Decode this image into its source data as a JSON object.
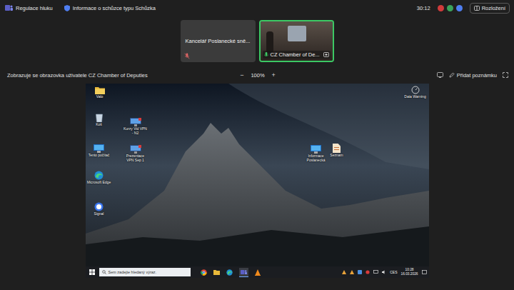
{
  "window": {
    "title": "Regulace hluku"
  },
  "meeting_info": {
    "label": "Informace o schůzce typu Schůzka"
  },
  "timer": "30:12",
  "status_icons": [
    {
      "name": "recording",
      "color": "#d13b3b"
    },
    {
      "name": "copilot",
      "color": "#3aa35a"
    },
    {
      "name": "people",
      "color": "#4f7ef0"
    }
  ],
  "layout_button": {
    "label": "Rozložení"
  },
  "participants": [
    {
      "name": "Kancelář Poslanecké sně...",
      "muted": true,
      "video": false,
      "selected": false
    },
    {
      "name": "CZ Chamber of De...",
      "muted": false,
      "video": true,
      "selected": true
    }
  ],
  "share": {
    "label": "Zobrazuje se obrazovka uživatele CZ Chamber of Deputies",
    "zoom_out": "−",
    "zoom": "100%",
    "zoom_in": "+",
    "annotate": "Přidat poznámku"
  },
  "desktop": {
    "icons": [
      {
        "label": "Valo",
        "kind": "folder"
      },
      {
        "label": "Koš",
        "kind": "recycle"
      },
      {
        "label": "Kurzy Vid VPN - N2",
        "kind": "monitor"
      },
      {
        "label": "Tento počítač",
        "kind": "pc"
      },
      {
        "label": "Prezentace VPN Sep 1",
        "kind": "monitor"
      },
      {
        "label": "Microsoft Edge",
        "kind": "edge"
      },
      {
        "label": "Signal",
        "kind": "signal"
      },
      {
        "label": "Informace Poslanecká",
        "kind": "pc"
      },
      {
        "label": "Seznam",
        "kind": "document"
      }
    ],
    "widget": {
      "label": "Data Warning"
    }
  },
  "taskbar": {
    "search_placeholder": "Sem zadejte hledaný výraz.",
    "language": "CES",
    "time": "10:28",
    "date": "16.03.2026"
  }
}
